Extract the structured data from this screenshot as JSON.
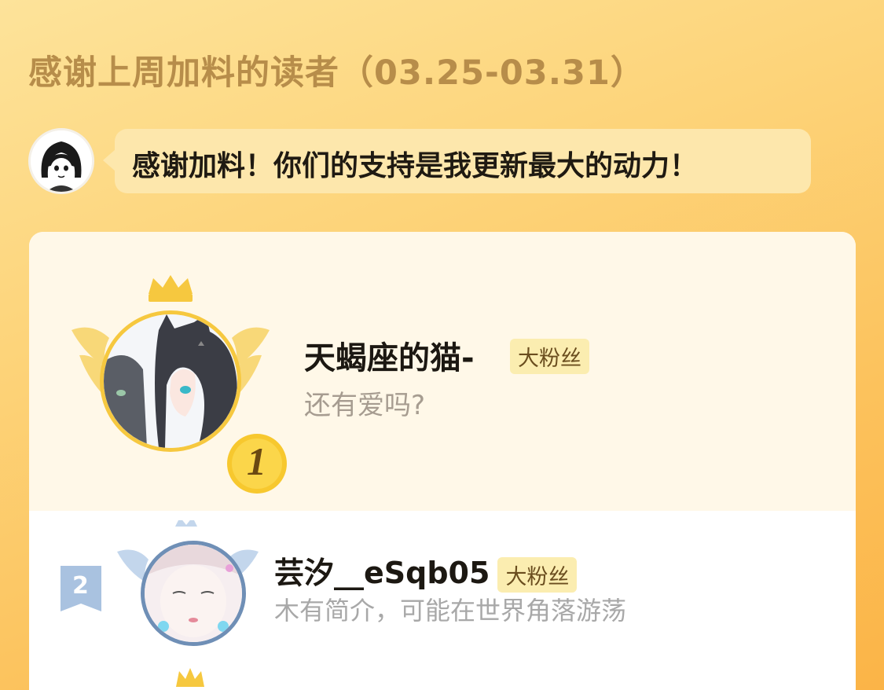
{
  "header": {
    "title": "感谢上周加料的读者（03.25-03.31）"
  },
  "author_message": {
    "avatar_icon": "author-avatar",
    "text": "感谢加料！你们的支持是我更新最大的动力！"
  },
  "supporters": [
    {
      "rank": "1",
      "name": "天蝎座的猫-",
      "badge": "大粉丝",
      "intro": "还有爱吗?",
      "frame_color": "#f6c83f"
    },
    {
      "rank": "2",
      "name": "芸汐__eSqb05",
      "badge": "大粉丝",
      "intro": "木有简介，可能在世界角落游荡",
      "frame_color": "#6f8fb6"
    }
  ],
  "colors": {
    "background_start": "#fde39a",
    "background_end": "#fbb447",
    "title": "#b78d4a",
    "bubble": "#fde7ac",
    "badge_bg": "#fbedb0",
    "gold": "#f6c83f",
    "silver_blue": "#6f8fb6"
  }
}
